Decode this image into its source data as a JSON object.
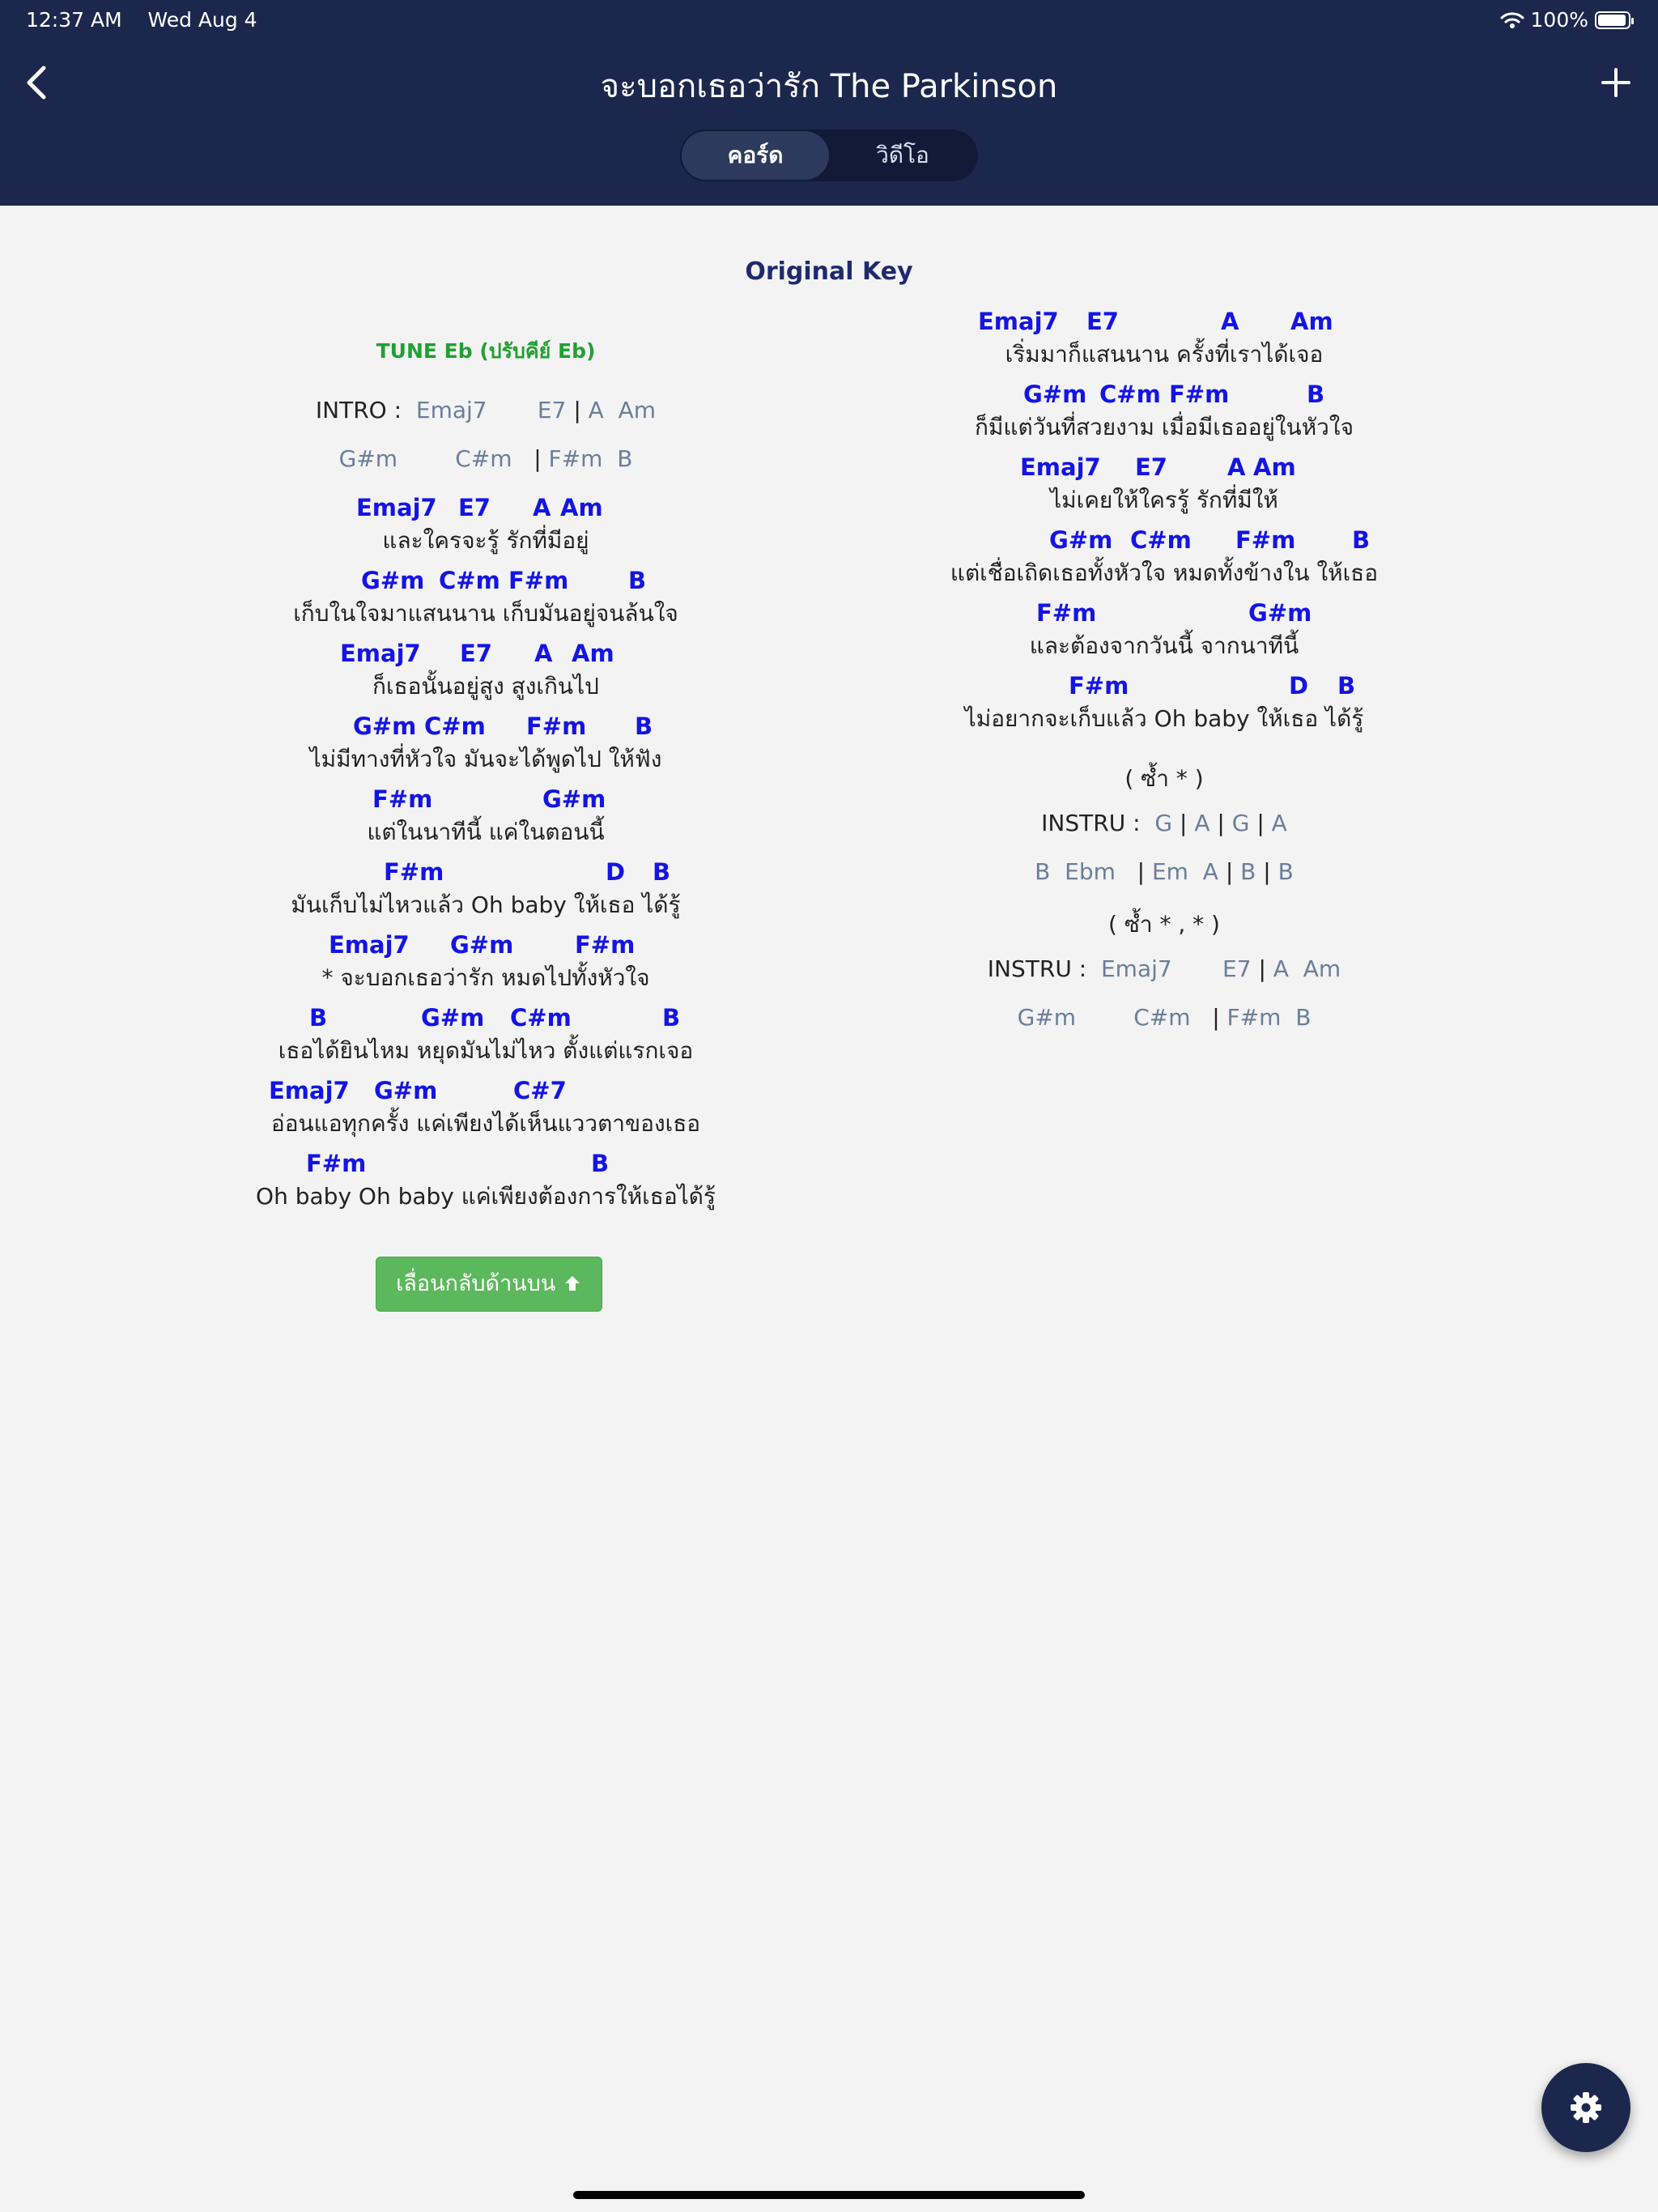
{
  "status_bar": {
    "time": "12:37 AM",
    "date": "Wed Aug 4",
    "battery": "100%"
  },
  "header": {
    "title": "จะบอกเธอว่ารัก The Parkinson",
    "tabs": [
      "คอร์ด",
      "วิดีโอ"
    ],
    "active_tab": "คอร์ด"
  },
  "original_key": "Original Key",
  "left": {
    "tune": "TUNE Eb (ปรับคีย์ Eb)",
    "intro": {
      "label": "INTRO :",
      "chords": [
        "Emaj7",
        "E7",
        "|",
        "A",
        "Am"
      ]
    },
    "intro2": [
      "G#m",
      "C#m",
      "|",
      "F#m",
      "B"
    ],
    "blocks": [
      {
        "chords": [
          "Emaj7",
          "E7",
          "A",
          "Am"
        ],
        "lyric": "และใครจะรู้ รักที่มีอยู่"
      },
      {
        "chords": [
          "G#m",
          "C#m",
          "F#m",
          "B"
        ],
        "lyric": "เก็บในใจมาแสนนาน เก็บมันอยู่จนล้นใจ"
      },
      {
        "chords": [
          "Emaj7",
          "E7",
          "A",
          "Am"
        ],
        "lyric": "ก็เธอนั้นอยู่สูง สูงเกินไป"
      },
      {
        "chords": [
          "G#m",
          "C#m",
          "F#m",
          "B"
        ],
        "lyric": "ไม่มีทางที่หัวใจ มันจะได้พูดไป ให้ฟัง"
      },
      {
        "chords": [
          "F#m",
          "G#m"
        ],
        "lyric": "แต่ในนาทีนี้ แค่ในตอนนี้"
      },
      {
        "chords": [
          "F#m",
          "D",
          "B"
        ],
        "lyric": "มันเก็บไม่ไหวแล้ว Oh baby ให้เธอ ได้รู้"
      },
      {
        "chords": [
          "Emaj7",
          "G#m",
          "F#m"
        ],
        "lyric": "* จะบอกเธอว่ารัก หมดไปทั้งหัวใจ"
      },
      {
        "chords": [
          "B",
          "G#m",
          "C#m",
          "B"
        ],
        "lyric": "เธอได้ยินไหม หยุดมันไม่ไหว ตั้งแต่แรกเจอ"
      },
      {
        "chords": [
          "Emaj7",
          "G#m",
          "C#7"
        ],
        "lyric": "อ่อนแอทุกครั้ง แค่เพียงได้เห็นแววตาของเธอ"
      },
      {
        "chords": [
          "F#m",
          "B"
        ],
        "lyric": "Oh baby Oh baby แค่เพียงต้องการให้เธอได้รู้"
      }
    ],
    "scroll_top_button": "เลื่อนกลับด้านบน"
  },
  "right": {
    "blocks": [
      {
        "chords": [
          "Emaj7",
          "E7",
          "A",
          "Am"
        ],
        "lyric": "เริ่มมาก็แสนนาน ครั้งที่เราได้เจอ"
      },
      {
        "chords": [
          "G#m",
          "C#m",
          "F#m",
          "B"
        ],
        "lyric": "ก็มีแต่วันที่สวยงาม เมื่อมีเธออยู่ในหัวใจ"
      },
      {
        "chords": [
          "Emaj7",
          "E7",
          "A",
          "Am"
        ],
        "lyric": "ไม่เคยให้ใครรู้ รักที่มีให้"
      },
      {
        "chords": [
          "G#m",
          "C#m",
          "F#m",
          "B"
        ],
        "lyric": "แต่เชื่อเถิดเธอทั้งหัวใจ หมดทั้งข้างใน ให้เธอ"
      },
      {
        "chords": [
          "F#m",
          "G#m"
        ],
        "lyric": "และต้องจากวันนี้ จากนาทีนี้"
      },
      {
        "chords": [
          "F#m",
          "D",
          "B"
        ],
        "lyric": "ไม่อยากจะเก็บแล้ว Oh baby ให้เธอ ได้รู้"
      }
    ],
    "repeat1": "( ซ้ำ * )",
    "instru1": {
      "label": "INSTRU :",
      "chords": [
        "G",
        "|",
        "A",
        "|",
        "G",
        "|",
        "A"
      ]
    },
    "instru1b": [
      "B",
      "Ebm",
      "|",
      "Em",
      "A",
      "|",
      "B",
      "|",
      "B"
    ],
    "repeat2": "( ซ้ำ * , * )",
    "instru2": {
      "label": "INSTRU :",
      "chords": [
        "Emaj7",
        "E7",
        "|",
        "A",
        "Am"
      ]
    },
    "instru2b": [
      "G#m",
      "C#m",
      "|",
      "F#m",
      "B"
    ]
  },
  "icons": {
    "back": "chevron-left-icon",
    "add": "plus-icon",
    "settings": "gear-icon",
    "scroll_up": "arrow-up-icon"
  },
  "colors": {
    "header": "#1c274d",
    "chord": "#1414e6",
    "grey_chord": "#6b7e9a",
    "tune": "#22a033",
    "button": "#5cb85c"
  }
}
